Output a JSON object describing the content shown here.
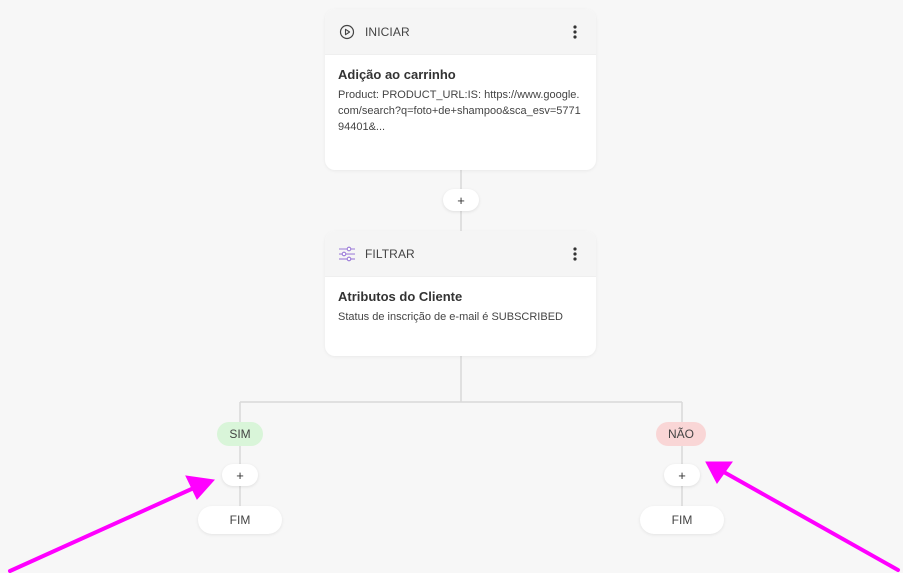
{
  "colors": {
    "background": "#f7f7f7",
    "card": "#ffffff",
    "card_header": "#f5f5f5",
    "connector": "#d9d9d9",
    "yes_pill": "#d9f5d9",
    "no_pill": "#f9d6d6",
    "annotation_arrow": "#ff00ff",
    "filter_icon": "#9b7ad8"
  },
  "trigger_card": {
    "icon": "play-circle-icon",
    "header_label": "INICIAR",
    "title": "Adição ao carrinho",
    "description": "Product: PRODUCT_URL:IS: https://www.google.com/search?q=foto+de+shampoo&sca_esv=577194401&..."
  },
  "add_step_after_trigger": {
    "label": "+"
  },
  "filter_card": {
    "icon": "sliders-icon",
    "header_label": "FILTRAR",
    "title": "Atributos do Cliente",
    "description": "Status de inscrição de e-mail é SUBSCRIBED"
  },
  "branch_yes": {
    "label": "SIM",
    "add_label": "+",
    "end_label": "FIM"
  },
  "branch_no": {
    "label": "NÃO",
    "add_label": "+",
    "end_label": "FIM"
  }
}
